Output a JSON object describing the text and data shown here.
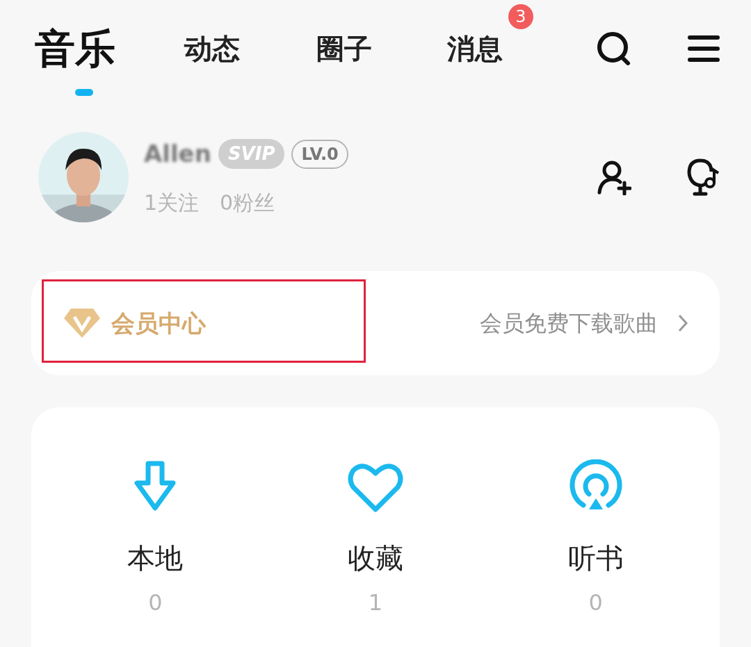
{
  "tabs": [
    {
      "label": "音乐",
      "selected": true
    },
    {
      "label": "动态",
      "selected": false
    },
    {
      "label": "圈子",
      "selected": false
    },
    {
      "label": "消息",
      "selected": false,
      "badge": "3"
    }
  ],
  "profile": {
    "name": "Allen",
    "blurred": true,
    "badges": [
      {
        "label": "SVIP",
        "kind": "filled"
      },
      {
        "label": "LV.0",
        "kind": "outline"
      }
    ],
    "following": "1关注",
    "followers": "0粉丝"
  },
  "vip_card": {
    "title": "会员中心",
    "subtitle": "会员免费下载歌曲",
    "highlighted": true
  },
  "shortcuts": [
    {
      "label": "本地",
      "count": "0",
      "kind": "download"
    },
    {
      "label": "收藏",
      "count": "1",
      "kind": "heart"
    },
    {
      "label": "听书",
      "count": "0",
      "kind": "broadcast"
    }
  ]
}
